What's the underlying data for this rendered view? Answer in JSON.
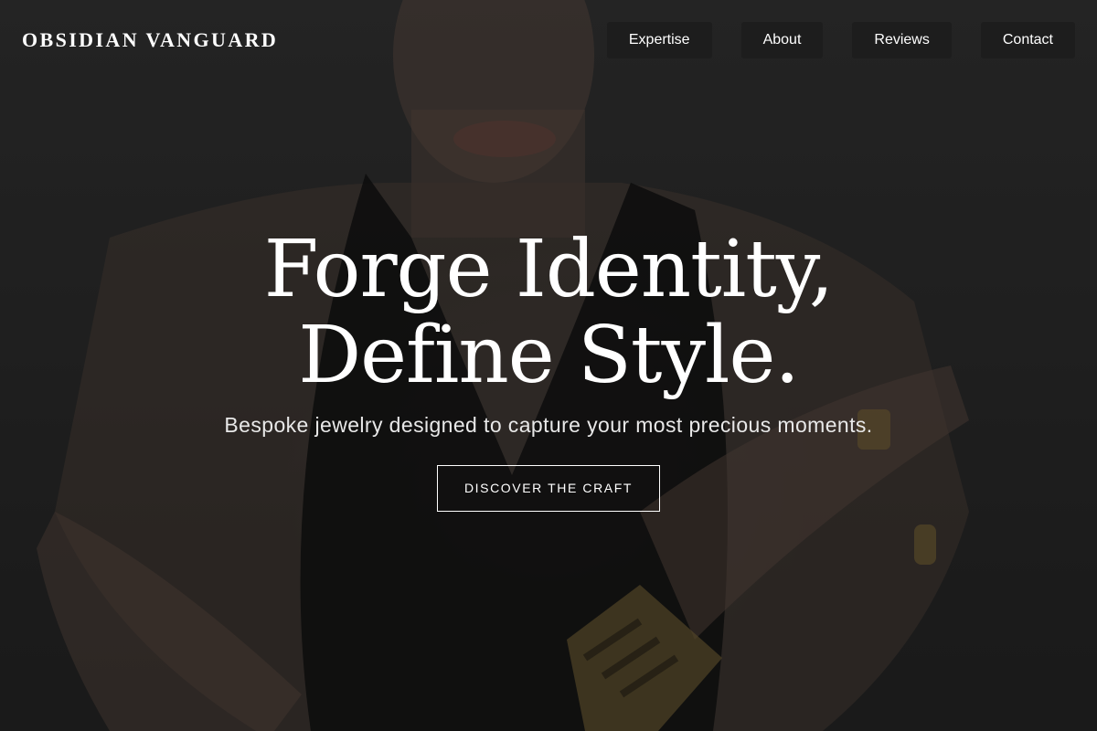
{
  "brand": {
    "name": "OBSIDIAN VANGUARD"
  },
  "nav": {
    "items": [
      {
        "label": "Expertise"
      },
      {
        "label": "About"
      },
      {
        "label": "Reviews"
      },
      {
        "label": "Contact"
      }
    ]
  },
  "hero": {
    "headline_line1": "Forge Identity,",
    "headline_line2": "Define Style.",
    "subheadline": "Bespoke jewelry designed to capture your most precious moments.",
    "cta_label": "DISCOVER THE CRAFT",
    "background_image": "woman-in-black-halter-top-with-gold-rings-and-cuff-bracelets"
  },
  "colors": {
    "nav_button_bg": "#1d1d1d",
    "text": "#ffffff",
    "background": "#2e2e2e"
  }
}
